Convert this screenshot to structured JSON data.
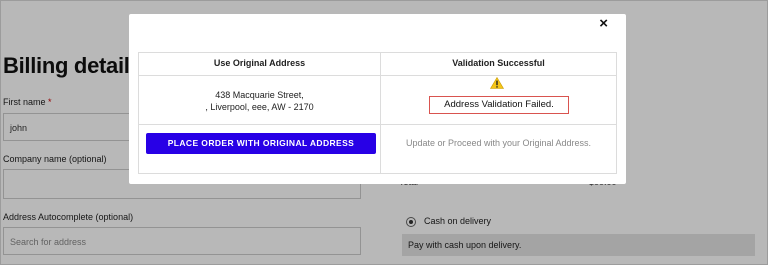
{
  "page": {
    "title": "Billing details",
    "first_name_label": "First name",
    "required_mark": "*",
    "first_name_value": "john",
    "company_label": "Company name (optional)",
    "autocomplete_label": "Address Autocomplete (optional)",
    "autocomplete_placeholder": "Search for address",
    "total_label": "Total",
    "total_value": "$00.00",
    "payment_option": "Cash on delivery",
    "payment_desc": "Pay with cash upon delivery."
  },
  "modal": {
    "close_label": "×",
    "col_original_header": "Use Original Address",
    "col_validation_header": "Validation Successful",
    "address_line1": "438 Macquarie Street,",
    "address_line2": ", Liverpool, eee, AW - 2170",
    "validation_message": "Address Validation Failed.",
    "place_order_label": "PLACE ORDER WITH ORIGINAL ADDRESS",
    "hint": "Update or Proceed with your Original Address."
  },
  "colors": {
    "button": "#2800e6",
    "highlight_border": "#d9534f",
    "warning_icon": "#f5c518"
  }
}
